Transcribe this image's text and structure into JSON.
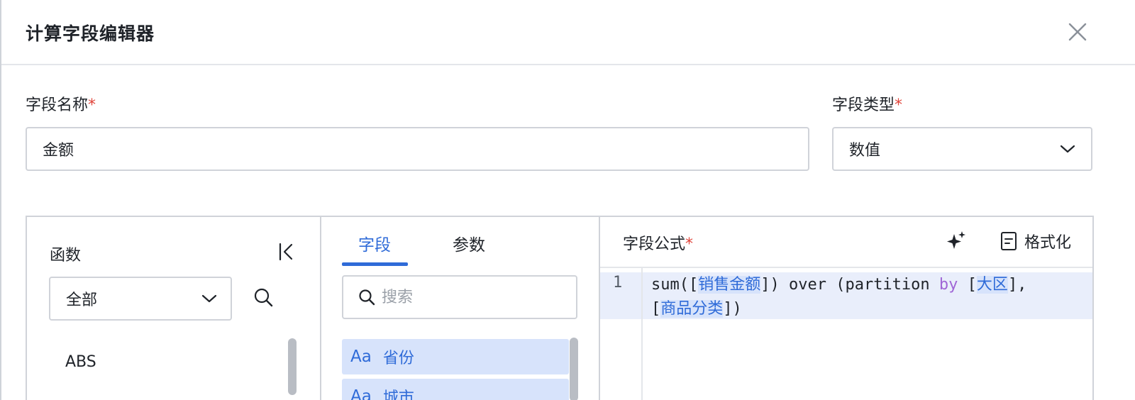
{
  "dialog": {
    "title": "计算字段编辑器"
  },
  "form": {
    "name_label": "字段名称",
    "name_value": "金额",
    "type_label": "字段类型",
    "type_value": "数值",
    "required_mark": "*"
  },
  "functions": {
    "title": "函数",
    "category": "全部",
    "items": [
      "ABS"
    ]
  },
  "fields_panel": {
    "tabs": [
      {
        "label": "字段",
        "active": true
      },
      {
        "label": "参数",
        "active": false
      }
    ],
    "search_placeholder": "搜索",
    "items": [
      {
        "type": "Aa",
        "label": "省份"
      },
      {
        "type": "Aa",
        "label": "城市"
      }
    ]
  },
  "formula": {
    "title": "字段公式",
    "format_label": "格式化",
    "line_number": "1",
    "tokens": {
      "t1": "sum([",
      "f1": "销售金额",
      "t2": "]) over (partition ",
      "kw": "by",
      "t3": " [",
      "f2": "大区",
      "t4": "],",
      "t5": "[",
      "f3": "商品分类",
      "t6": "])"
    }
  },
  "colors": {
    "accent": "#2f6bd8",
    "required": "#e0443a",
    "field_highlight": "#d7e3fb",
    "keyword": "#a066d6"
  },
  "icons": [
    "close-icon",
    "chevron-down-icon",
    "collapse-left-icon",
    "search-icon",
    "sparkle-icon",
    "format-document-icon"
  ]
}
